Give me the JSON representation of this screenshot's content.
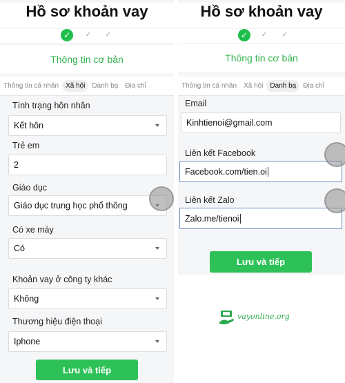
{
  "left": {
    "title": "Hồ sơ khoản vay",
    "step_check": "✓",
    "subtitle": "Thông tin cơ bản",
    "tabs": [
      "Thông tin cá nhân",
      "Xã hội",
      "Danh bạ",
      "Địa chỉ"
    ],
    "active_tab": 1,
    "fields": [
      {
        "label": "Tình trạng hôn nhân",
        "value": "Kết hôn",
        "kind": "select"
      },
      {
        "label": "Trẻ em",
        "value": "2",
        "kind": "input"
      },
      {
        "label": "Giáo dục",
        "value": "Giáo dục trung học phổ thông",
        "kind": "select"
      },
      {
        "label": "Có xe máy",
        "value": "Có",
        "kind": "select"
      },
      {
        "label": "Khoản vay ở công ty khác",
        "value": "Không",
        "kind": "select"
      },
      {
        "label": "Thương hiệu điện thoại",
        "value": "Iphone",
        "kind": "select"
      }
    ],
    "button": "Lưu và tiếp"
  },
  "right": {
    "title": "Hồ sơ khoản vay",
    "step_check": "✓",
    "subtitle": "Thông tin cơ bản",
    "tabs": [
      "Thông tin cá nhân",
      "Xã hội",
      "Danh bạ",
      "Địa chỉ"
    ],
    "active_tab": 2,
    "fields": [
      {
        "label": "Email",
        "value": "Kinhtienoi@gmail.com",
        "kind": "input"
      },
      {
        "label": "Liên kết Facebook",
        "value": "Facebook.com/tien.oi",
        "kind": "input"
      },
      {
        "label": "Liên kết Zalo",
        "value": "Zalo.me/tienoi",
        "kind": "input"
      }
    ],
    "button": "Lưu và tiếp"
  },
  "watermark": {
    "text": "vayonline.org",
    "icon": "hand-money-icon"
  },
  "colors": {
    "brand_green": "#2ec158",
    "subtitle_green": "#2fb34a",
    "focus_border": "#6e8fc4"
  }
}
